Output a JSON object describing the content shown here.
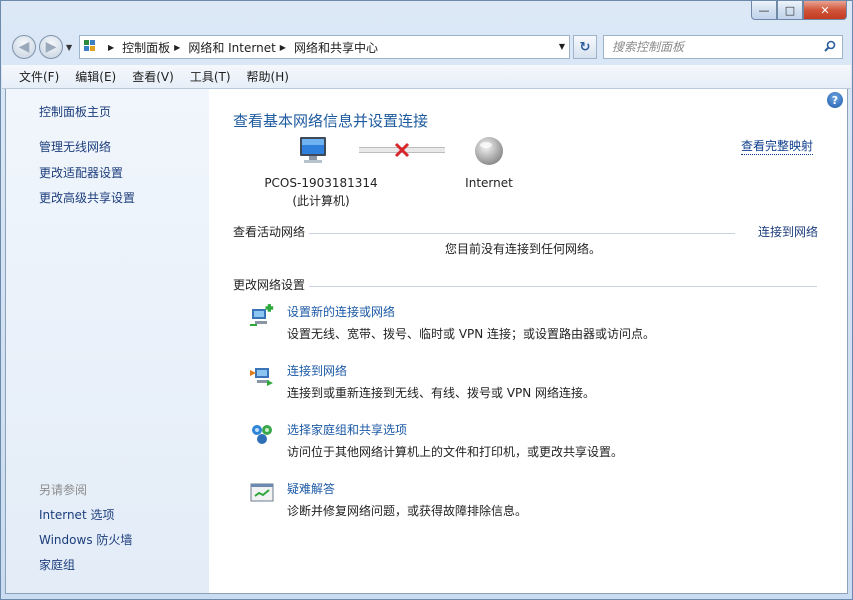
{
  "window": {
    "caption_minimize": "—",
    "caption_maximize": "□",
    "caption_close": "✕"
  },
  "nav": {
    "back_icon": "back-arrow-icon",
    "forward_icon": "forward-arrow-icon"
  },
  "address": {
    "crumbs": [
      "控制面板",
      "网络和 Internet",
      "网络和共享中心"
    ]
  },
  "search": {
    "placeholder": "搜索控制面板"
  },
  "menu": {
    "items": [
      "文件(F)",
      "编辑(E)",
      "查看(V)",
      "工具(T)",
      "帮助(H)"
    ]
  },
  "sidebar": {
    "home": "控制面板主页",
    "links": [
      "管理无线网络",
      "更改适配器设置",
      "更改高级共享设置"
    ],
    "see_also_heading": "另请参阅",
    "see_also": [
      "Internet 选项",
      "Windows 防火墙",
      "家庭组"
    ]
  },
  "main": {
    "title": "查看基本网络信息并设置连接",
    "full_map": "查看完整映射",
    "computer_name": "PCOS-1903181314",
    "computer_sub": "(此计算机)",
    "internet_label": "Internet",
    "active_networks_heading": "查看活动网络",
    "connect_link": "连接到网络",
    "no_network": "您目前没有连接到任何网络。",
    "change_settings_heading": "更改网络设置",
    "tasks": [
      {
        "link": "设置新的连接或网络",
        "desc": "设置无线、宽带、拨号、临时或 VPN 连接；或设置路由器或访问点。",
        "icon": "new-connection-icon"
      },
      {
        "link": "连接到网络",
        "desc": "连接到或重新连接到无线、有线、拨号或 VPN 网络连接。",
        "icon": "connect-network-icon"
      },
      {
        "link": "选择家庭组和共享选项",
        "desc": "访问位于其他网络计算机上的文件和打印机，或更改共享设置。",
        "icon": "homegroup-icon"
      },
      {
        "link": "疑难解答",
        "desc": "诊断并修复网络问题，或获得故障排除信息。",
        "icon": "troubleshoot-icon"
      }
    ]
  },
  "colors": {
    "link": "#1c5aa6",
    "title": "#1d5a9e",
    "disconnect": "#d8262a"
  }
}
